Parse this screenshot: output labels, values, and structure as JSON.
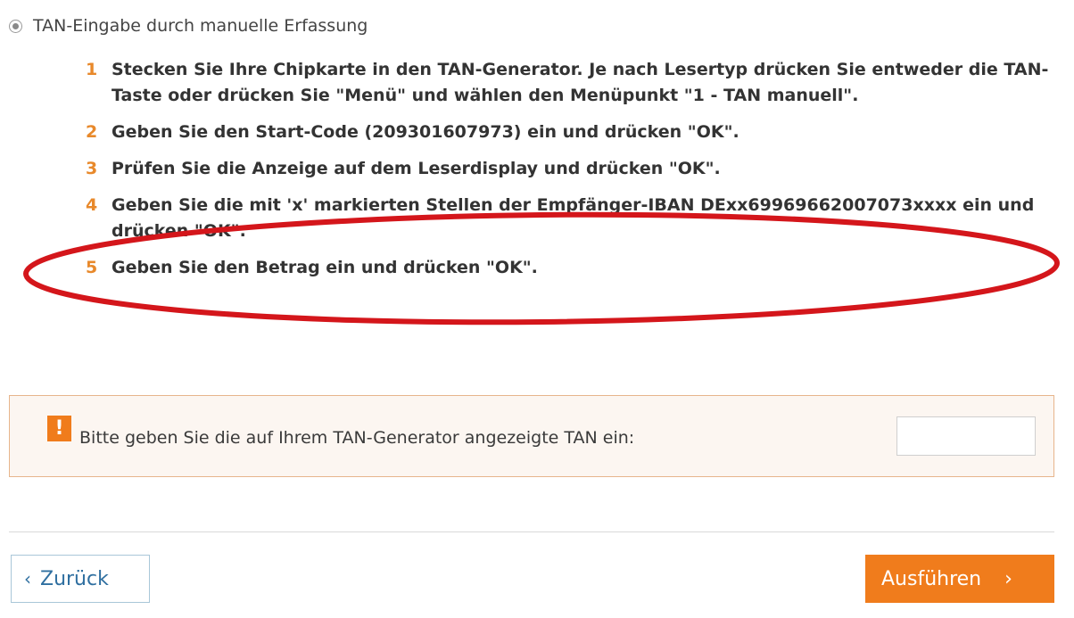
{
  "option": {
    "label": "TAN-Eingabe durch manuelle Erfassung",
    "selected": true
  },
  "steps": [
    {
      "number": "1",
      "text": "Stecken Sie Ihre Chipkarte in den TAN-Generator. Je nach Lesertyp drücken Sie entweder die TAN-Taste oder drücken Sie \"Menü\" und wählen den Menüpunkt \"1 - TAN manuell\"."
    },
    {
      "number": "2",
      "text": "Geben Sie den Start-Code (209301607973) ein und drücken \"OK\"."
    },
    {
      "number": "3",
      "text": "Prüfen Sie die Anzeige auf dem Leserdisplay und drücken \"OK\"."
    },
    {
      "number": "4",
      "text": "Geben Sie die mit 'x' markierten Stellen der Empfänger-IBAN DExx69969662007073xxxx ein und drücken \"OK\"."
    },
    {
      "number": "5",
      "text": "Geben Sie den Betrag ein und drücken \"OK\"."
    }
  ],
  "tan_prompt": {
    "warning_glyph": "!",
    "label": "Bitte geben Sie die auf Ihrem TAN-Generator angezeigte TAN ein:",
    "value": "",
    "placeholder": ""
  },
  "buttons": {
    "back_label": "Zurück",
    "back_icon": "chevron-left-icon",
    "execute_label": "Ausführen",
    "execute_icon": "chevron-right-icon"
  },
  "colors": {
    "accent": "#f07c1c",
    "step_number": "#e8892b",
    "annotation": "#d4161b",
    "link": "#2f6fa0"
  }
}
